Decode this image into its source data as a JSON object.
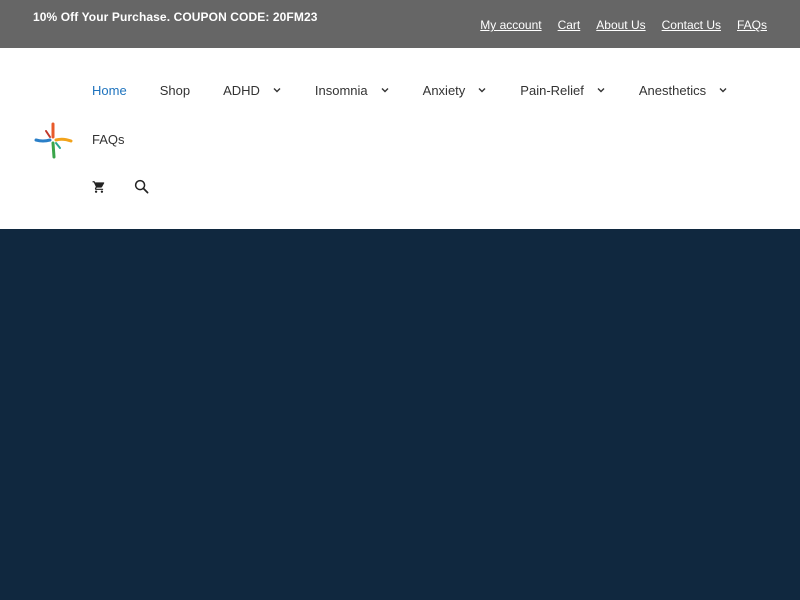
{
  "topbar": {
    "promo": "10% Off Your Purchase. COUPON CODE: 20FM23",
    "links": [
      "My account",
      "Cart",
      "About Us",
      "Contact Us",
      "FAQs"
    ]
  },
  "nav": {
    "items": [
      {
        "label": "Home",
        "active": true,
        "dropdown": false
      },
      {
        "label": "Shop",
        "active": false,
        "dropdown": false
      },
      {
        "label": "ADHD",
        "active": false,
        "dropdown": true
      },
      {
        "label": "Insomnia",
        "active": false,
        "dropdown": true
      },
      {
        "label": "Anxiety",
        "active": false,
        "dropdown": true
      },
      {
        "label": "Pain-Relief",
        "active": false,
        "dropdown": true
      },
      {
        "label": "Anesthetics",
        "active": false,
        "dropdown": true
      }
    ],
    "second_row_item": "FAQs"
  },
  "icons": {
    "cart": "cart-icon",
    "search": "search-icon",
    "chevron": "chevron-down-icon",
    "logo": "logo-icon"
  },
  "colors": {
    "topbar_bg": "#666666",
    "active_link": "#1e73be",
    "hero_bg": "#10283f"
  }
}
